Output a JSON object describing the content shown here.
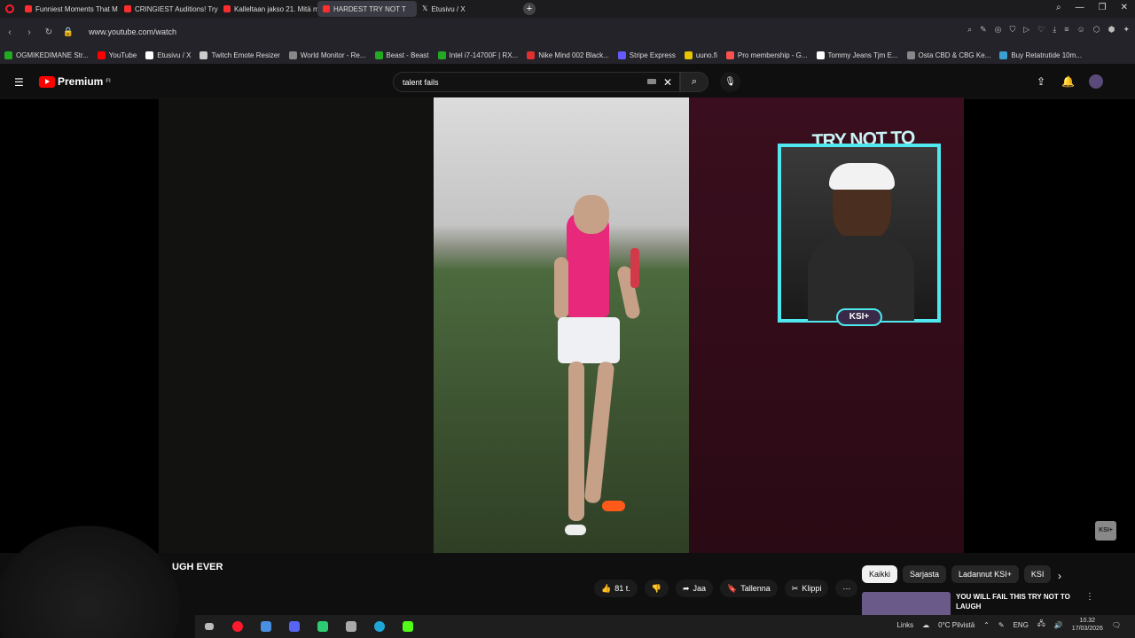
{
  "browser": {
    "tabs": [
      {
        "title": "Funniest Moments That M",
        "active": false
      },
      {
        "title": "CRINGIEST Auditions! Try",
        "active": false
      },
      {
        "title": "Kalleltaan jakso 21. Mitä m",
        "active": false
      },
      {
        "title": "HARDEST TRY NOT T",
        "active": true
      },
      {
        "title": "Etusivu / X",
        "active": false
      }
    ],
    "url": "www.youtube.com/watch",
    "bookmarks": [
      {
        "label": "OGMIKEDIMANE Str...",
        "color": "#22aa22"
      },
      {
        "label": "YouTube",
        "color": "#ff0000"
      },
      {
        "label": "Etusivu / X",
        "color": "#ffffff"
      },
      {
        "label": "Twitch Emote Resizer",
        "color": "#cccccc"
      },
      {
        "label": "World Monitor - Re...",
        "color": "#888888"
      },
      {
        "label": "Beast - Beast",
        "color": "#22aa22"
      },
      {
        "label": "Intel i7-14700F | RX...",
        "color": "#22aa22"
      },
      {
        "label": "Nike Mind 002 Black...",
        "color": "#e03030"
      },
      {
        "label": "Stripe Express",
        "color": "#635bff"
      },
      {
        "label": "uuno.fi",
        "color": "#e8c400"
      },
      {
        "label": "Pro membership - G...",
        "color": "#ff5050"
      },
      {
        "label": "Tommy Jeans Tjm E...",
        "color": "#ffffff"
      },
      {
        "label": "Osta CBD & CBG Ke...",
        "color": "#888888"
      },
      {
        "label": "Buy Retatrutide 10m...",
        "color": "#3aa0d0"
      }
    ]
  },
  "youtube": {
    "logo_label": "Premium",
    "logo_country": "FI",
    "search_value": "talent fails",
    "video": {
      "overlay_title": "TRY NOT TO LAUGH",
      "badge": "KSI+",
      "watermark": "KSI+"
    },
    "title_partial": "UGH EVER",
    "actions": {
      "likes": "81 t.",
      "share": "Jaa",
      "save": "Tallenna",
      "clip": "Klippi"
    },
    "chips": [
      "Kaikki",
      "Sarjasta",
      "Ladannut KSI+",
      "KSI"
    ],
    "recommendation": {
      "title": "YOU WILL FAIL THIS TRY NOT TO LAUGH"
    }
  },
  "taskbar": {
    "links_label": "Links",
    "weather": "0°C  Pilvistä",
    "lang": "ENG",
    "time": "10.32",
    "date": "17/03/2026"
  }
}
